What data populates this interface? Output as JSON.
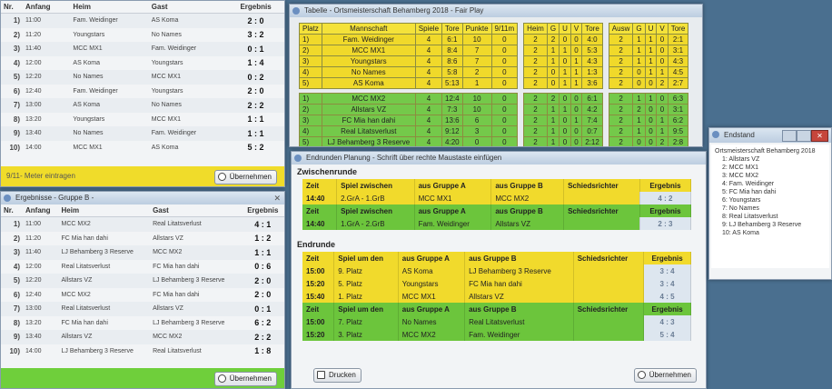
{
  "window_a": {
    "headers": [
      "Nr.",
      "Anfang",
      "Heim",
      "Gast",
      "Ergebnis"
    ],
    "rows": [
      {
        "nr": "1)",
        "time": "11:00",
        "home": "Fam. Weidinger",
        "guest": "AS Koma",
        "result": "2 : 0"
      },
      {
        "nr": "2)",
        "time": "11:20",
        "home": "Youngstars",
        "guest": "No Names",
        "result": "3 : 2"
      },
      {
        "nr": "3)",
        "time": "11:40",
        "home": "MCC MX1",
        "guest": "Fam. Weidinger",
        "result": "0 : 1"
      },
      {
        "nr": "4)",
        "time": "12:00",
        "home": "AS Koma",
        "guest": "Youngstars",
        "result": "1 : 4"
      },
      {
        "nr": "5)",
        "time": "12:20",
        "home": "No Names",
        "guest": "MCC MX1",
        "result": "0 : 2"
      },
      {
        "nr": "6)",
        "time": "12:40",
        "home": "Fam. Weidinger",
        "guest": "Youngstars",
        "result": "2 : 0"
      },
      {
        "nr": "7)",
        "time": "13:00",
        "home": "AS Koma",
        "guest": "No Names",
        "result": "2 : 2"
      },
      {
        "nr": "8)",
        "time": "13:20",
        "home": "Youngstars",
        "guest": "MCC MX1",
        "result": "1 : 1"
      },
      {
        "nr": "9)",
        "time": "13:40",
        "home": "No Names",
        "guest": "Fam. Weidinger",
        "result": "1 : 1"
      },
      {
        "nr": "10)",
        "time": "14:00",
        "home": "MCC MX1",
        "guest": "AS Koma",
        "result": "5 : 2"
      }
    ],
    "footer_label": "9/11- Meter eintragen",
    "button_label": "Übernehmen"
  },
  "window_b": {
    "title": "Ergebnisse - Gruppe B -",
    "headers": [
      "Nr.",
      "Anfang",
      "Heim",
      "Gast",
      "Ergebnis"
    ],
    "rows": [
      {
        "nr": "1)",
        "time": "11:00",
        "home": "MCC MX2",
        "guest": "Real Litatsverlust",
        "result": "4 : 1"
      },
      {
        "nr": "2)",
        "time": "11:20",
        "home": "FC Mia han dahi",
        "guest": "Allstars VZ",
        "result": "1 : 2"
      },
      {
        "nr": "3)",
        "time": "11:40",
        "home": "LJ Behamberg 3 Reserve",
        "guest": "MCC MX2",
        "result": "1 : 1"
      },
      {
        "nr": "4)",
        "time": "12:00",
        "home": "Real Litatsverlust",
        "guest": "FC Mia han dahi",
        "result": "0 : 6"
      },
      {
        "nr": "5)",
        "time": "12:20",
        "home": "Allstars VZ",
        "guest": "LJ Behamberg 3 Reserve",
        "result": "2 : 0"
      },
      {
        "nr": "6)",
        "time": "12:40",
        "home": "MCC MX2",
        "guest": "FC Mia han dahi",
        "result": "2 : 0"
      },
      {
        "nr": "7)",
        "time": "13:00",
        "home": "Real Litatsverlust",
        "guest": "Allstars VZ",
        "result": "0 : 1"
      },
      {
        "nr": "8)",
        "time": "13:20",
        "home": "FC Mia han dahi",
        "guest": "LJ Behamberg 3 Reserve",
        "result": "6 : 2"
      },
      {
        "nr": "9)",
        "time": "13:40",
        "home": "Allstars VZ",
        "guest": "MCC MX2",
        "result": "2 : 2"
      },
      {
        "nr": "10)",
        "time": "14:00",
        "home": "LJ Behamberg 3 Reserve",
        "guest": "Real Litatsverlust",
        "result": "1 : 8"
      }
    ],
    "button_label": "Übernehmen"
  },
  "tabelle": {
    "title": "Tabelle - Ortsmeisterschaft Behamberg 2018 - Fair Play",
    "headers_main": [
      "Platz",
      "Mannschaft",
      "Spiele",
      "Tore",
      "Punkte",
      "9/11m"
    ],
    "headers_heim": [
      "Heim",
      "G",
      "U",
      "V",
      "Tore"
    ],
    "headers_ausw": [
      "Ausw",
      "G",
      "U",
      "V",
      "Tore"
    ],
    "group_a": [
      {
        "platz": "1)",
        "team": "Fam. Weidinger",
        "spiele": "4",
        "tore": "6:1",
        "punkte": "10",
        "m": "0",
        "heim": [
          "2",
          "2",
          "0",
          "0",
          "4:0"
        ],
        "ausw": [
          "2",
          "1",
          "1",
          "0",
          "2:1"
        ]
      },
      {
        "platz": "2)",
        "team": "MCC MX1",
        "spiele": "4",
        "tore": "8:4",
        "punkte": "7",
        "m": "0",
        "heim": [
          "2",
          "1",
          "1",
          "0",
          "5:3"
        ],
        "ausw": [
          "2",
          "1",
          "1",
          "0",
          "3:1"
        ]
      },
      {
        "platz": "3)",
        "team": "Youngstars",
        "spiele": "4",
        "tore": "8:6",
        "punkte": "7",
        "m": "0",
        "heim": [
          "2",
          "1",
          "0",
          "1",
          "4:3"
        ],
        "ausw": [
          "2",
          "1",
          "1",
          "0",
          "4:3"
        ]
      },
      {
        "platz": "4)",
        "team": "No Names",
        "spiele": "4",
        "tore": "5:8",
        "punkte": "2",
        "m": "0",
        "heim": [
          "2",
          "0",
          "1",
          "1",
          "1:3"
        ],
        "ausw": [
          "2",
          "0",
          "1",
          "1",
          "4:5"
        ]
      },
      {
        "platz": "5)",
        "team": "AS Koma",
        "spiele": "4",
        "tore": "5:13",
        "punkte": "1",
        "m": "0",
        "heim": [
          "2",
          "0",
          "1",
          "1",
          "3:6"
        ],
        "ausw": [
          "2",
          "0",
          "0",
          "2",
          "2:7"
        ]
      }
    ],
    "group_b": [
      {
        "platz": "1)",
        "team": "MCC MX2",
        "spiele": "4",
        "tore": "12:4",
        "punkte": "10",
        "m": "0",
        "heim": [
          "2",
          "2",
          "0",
          "0",
          "6:1"
        ],
        "ausw": [
          "2",
          "1",
          "1",
          "0",
          "6:3"
        ]
      },
      {
        "platz": "2)",
        "team": "Allstars VZ",
        "spiele": "4",
        "tore": "7:3",
        "punkte": "10",
        "m": "0",
        "heim": [
          "2",
          "1",
          "1",
          "0",
          "4:2"
        ],
        "ausw": [
          "2",
          "2",
          "0",
          "0",
          "3:1"
        ]
      },
      {
        "platz": "3)",
        "team": "FC Mia han dahi",
        "spiele": "4",
        "tore": "13:6",
        "punkte": "6",
        "m": "0",
        "heim": [
          "2",
          "1",
          "0",
          "1",
          "7:4"
        ],
        "ausw": [
          "2",
          "1",
          "0",
          "1",
          "6:2"
        ]
      },
      {
        "platz": "4)",
        "team": "Real Litatsverlust",
        "spiele": "4",
        "tore": "9:12",
        "punkte": "3",
        "m": "0",
        "heim": [
          "2",
          "1",
          "0",
          "0",
          "0:7"
        ],
        "ausw": [
          "2",
          "1",
          "0",
          "1",
          "9:5"
        ]
      },
      {
        "platz": "5)",
        "team": "LJ Behamberg 3 Reserve",
        "spiele": "4",
        "tore": "4:20",
        "punkte": "0",
        "m": "0",
        "heim": [
          "2",
          "1",
          "0",
          "0",
          "2:12"
        ],
        "ausw": [
          "2",
          "0",
          "0",
          "2",
          "2:8"
        ]
      }
    ]
  },
  "endrunde": {
    "title": "Endrunden Planung  -  Schrift über rechte Maustaste einfügen",
    "zwischen_title": "Zwischenrunde",
    "zwischen_headers": [
      "Zeit",
      "Spiel zwischen",
      "aus Gruppe A",
      "aus Gruppe B",
      "Schiedsrichter",
      "Ergebnis"
    ],
    "zwischen_rows": [
      {
        "zeit": "14:40",
        "spiel": "2.GrA - 1.GrB",
        "a": "MCC MX1",
        "b": "MCC MX2",
        "ref": "",
        "res": "4 : 2",
        "color": "y"
      },
      {
        "zeit": "14:40",
        "spiel": "1.GrA - 2.GrB",
        "a": "Fam. Weidinger",
        "b": "Allstars VZ",
        "ref": "",
        "res": "2 : 3",
        "color": "g"
      }
    ],
    "end_title": "Endrunde",
    "end_headers": [
      "Zeit",
      "Spiel um den",
      "aus Gruppe A",
      "aus Gruppe B",
      "Schiedsrichter",
      "Ergebnis"
    ],
    "end_rows": [
      {
        "zeit": "15:00",
        "spiel": "9. Platz",
        "a": "AS Koma",
        "b": "LJ Behamberg 3 Reserve",
        "res": "3 : 4",
        "color": "y"
      },
      {
        "zeit": "15:20",
        "spiel": "5. Platz",
        "a": "Youngstars",
        "b": "FC Mia han dahi",
        "res": "3 : 4",
        "color": "y"
      },
      {
        "zeit": "15:40",
        "spiel": "1. Platz",
        "a": "MCC MX1",
        "b": "Allstars VZ",
        "res": "4 : 5",
        "color": "y"
      },
      {
        "zeit": "15:00",
        "spiel": "7. Platz",
        "a": "No Names",
        "b": "Real Litatsverlust",
        "res": "4 : 3",
        "color": "g"
      },
      {
        "zeit": "15:20",
        "spiel": "3. Platz",
        "a": "MCC MX2",
        "b": "Fam. Weidinger",
        "res": "5 : 4",
        "color": "g"
      }
    ],
    "print_label": "Drucken",
    "apply_label": "Übernehmen"
  },
  "endstand": {
    "title": "Endstand",
    "root": "Ortsmeisterschaft Behamberg 2018",
    "items": [
      "1: Allstars VZ",
      "2: MCC MX1",
      "3: MCC MX2",
      "4: Fam. Weidinger",
      "5: FC Mia han dahi",
      "6: Youngstars",
      "7: No Names",
      "8: Real Litatsverlust",
      "9: LJ Behamberg 3 Reserve",
      "10: AS Koma"
    ]
  }
}
